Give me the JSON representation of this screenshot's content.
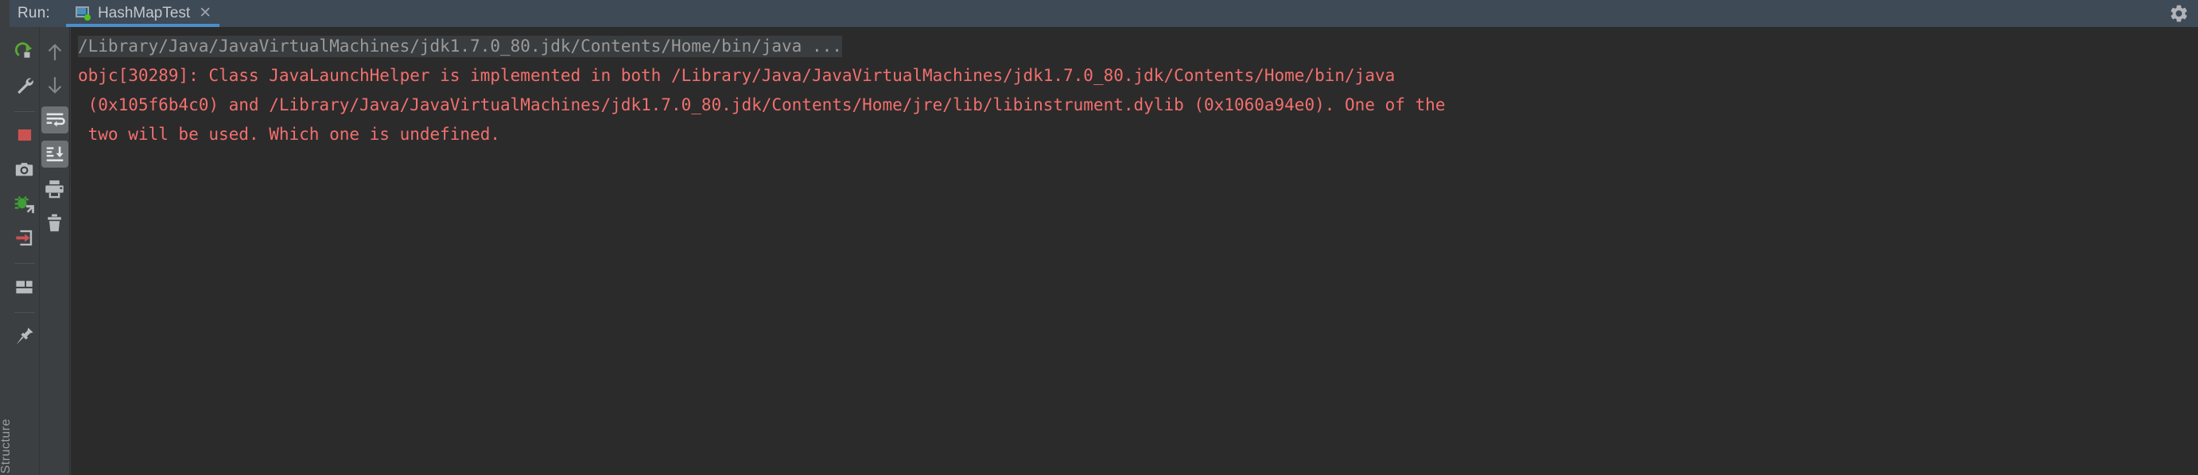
{
  "header": {
    "run_label": "Run:",
    "gear_icon": "gear-icon",
    "tabs": [
      {
        "label": "HashMapTest",
        "icon": "run-configuration-icon",
        "close_icon": "close-icon",
        "active": true
      }
    ]
  },
  "structure_panel": {
    "label": "Structure"
  },
  "toolbar_primary": {
    "buttons": [
      {
        "name": "rerun-button",
        "icon": "rerun-icon",
        "tooltip": "Rerun"
      },
      {
        "name": "edit-configuration-button",
        "icon": "wrench-icon",
        "tooltip": "Edit Configuration"
      },
      {
        "name": "stop-button",
        "icon": "stop-icon",
        "tooltip": "Stop"
      },
      {
        "name": "screenshot-button",
        "icon": "camera-icon",
        "tooltip": "Screenshot"
      },
      {
        "name": "attach-debugger-button",
        "icon": "bug-attach-icon",
        "tooltip": "Attach Debugger"
      },
      {
        "name": "dump-threads-button",
        "icon": "arrow-into-box-icon",
        "tooltip": "Dump Threads"
      },
      {
        "name": "restore-layout-button",
        "icon": "layout-icon",
        "tooltip": "Restore Layout"
      },
      {
        "name": "pin-tab-button",
        "icon": "pin-icon",
        "tooltip": "Pin Tab"
      }
    ]
  },
  "toolbar_secondary": {
    "buttons": [
      {
        "name": "scroll-up-button",
        "icon": "arrow-up-icon",
        "tooltip": "Up the Stack Trace",
        "toggled": false
      },
      {
        "name": "scroll-down-button",
        "icon": "arrow-down-icon",
        "tooltip": "Down the Stack Trace",
        "toggled": false
      },
      {
        "name": "soft-wrap-button",
        "icon": "soft-wrap-icon",
        "tooltip": "Use Soft Wraps",
        "toggled": true
      },
      {
        "name": "scroll-to-end-button",
        "icon": "scroll-to-end-icon",
        "tooltip": "Scroll to the End",
        "toggled": true
      },
      {
        "name": "print-button",
        "icon": "printer-icon",
        "tooltip": "Print",
        "toggled": false
      },
      {
        "name": "clear-all-button",
        "icon": "trash-icon",
        "tooltip": "Clear All",
        "toggled": false
      }
    ]
  },
  "console": {
    "lines": [
      {
        "type": "command",
        "highlighted": true,
        "text": "/Library/Java/JavaVirtualMachines/jdk1.7.0_80.jdk/Contents/Home/bin/java ..."
      },
      {
        "type": "error",
        "highlighted": false,
        "text": "objc[30289]: Class JavaLaunchHelper is implemented in both /Library/Java/JavaVirtualMachines/jdk1.7.0_80.jdk/Contents/Home/bin/java"
      },
      {
        "type": "error",
        "highlighted": false,
        "text": " (0x105f6b4c0) and /Library/Java/JavaVirtualMachines/jdk1.7.0_80.jdk/Contents/Home/jre/lib/libinstrument.dylib (0x1060a94e0). One of the"
      },
      {
        "type": "error",
        "highlighted": false,
        "text": " two will be used. Which one is undefined."
      }
    ]
  },
  "colors": {
    "window_bg": "#3c3f41",
    "console_bg": "#2b2b2b",
    "tab_bg": "#3f4a57",
    "tab_underline": "#4b8ec9",
    "error_text": "#f2706e",
    "command_text": "#9a9a9a",
    "toggled_button_bg": "#6e7174",
    "run_dot_green": "#4fc31c",
    "stop_red": "#cc5252"
  }
}
